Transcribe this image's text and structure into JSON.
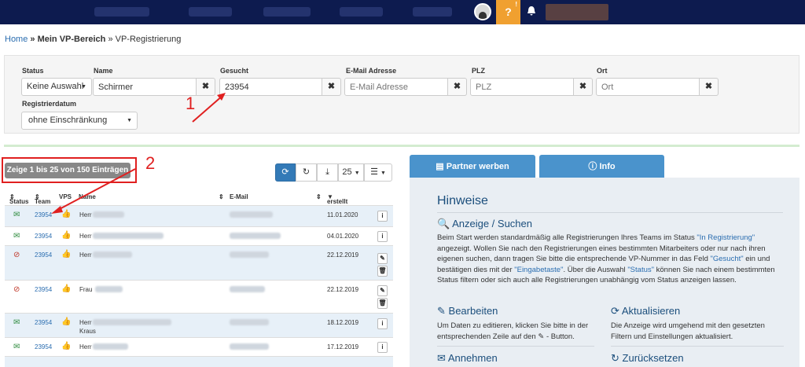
{
  "breadcrumb": {
    "home": "Home",
    "sep1": " » ",
    "mein": "Mein VP-Bereich",
    "sep2": " » ",
    "current": "VP-Registrierung"
  },
  "filter": {
    "status_label": "Status",
    "status_value": "Keine Auswahl",
    "name_label": "Name",
    "name_value": "Schirmer",
    "gesucht_label": "Gesucht",
    "gesucht_value": "23954",
    "email_label": "E-Mail Adresse",
    "email_placeholder": "E-Mail Adresse",
    "plz_label": "PLZ",
    "plz_placeholder": "PLZ",
    "ort_label": "Ort",
    "ort_placeholder": "Ort",
    "regdatum_label": "Registrierdatum",
    "regdatum_value": "ohne Einschränkung",
    "clear": "✖"
  },
  "annotations": {
    "one": "1",
    "two": "2"
  },
  "list": {
    "count_text": "Zeige 1 bis 25 von 150 Einträgen",
    "page_size": "25",
    "headers": {
      "status": "Status",
      "team": "Team",
      "vps": "VPS",
      "name": "Name",
      "email": "E-Mail",
      "erstellt": "erstellt"
    },
    "rows": [
      {
        "icon": "✉",
        "team": "23954",
        "anrede": "Herr",
        "date": "11.01.2020"
      },
      {
        "icon": "✉",
        "team": "23954",
        "anrede": "Herr",
        "date": "04.01.2020"
      },
      {
        "icon": "⊘",
        "team": "23954",
        "anrede": "Herr",
        "date": "22.12.2019"
      },
      {
        "icon": "⊘",
        "team": "23954",
        "anrede": "Frau",
        "date": "22.12.2019"
      },
      {
        "icon": "✉",
        "team": "23954",
        "anrede": "Herr",
        "anrede2": "Kraus",
        "date": "18.12.2019"
      },
      {
        "icon": "✉",
        "team": "23954",
        "anrede": "Herr",
        "date": "17.12.2019"
      }
    ]
  },
  "tabs": {
    "partner": "Partner werben",
    "info": "Info"
  },
  "hinweise": {
    "title": "Hinweise",
    "anzeige_title": "Anzeige / Suchen",
    "anzeige_text_1": "Beim Start werden standardmäßig alle Registrierungen Ihres Teams im Status ",
    "anzeige_hl_1": "\"In Registrierung\"",
    "anzeige_text_2": "angezeigt. Wollen Sie nach den Registrierungen eines bestimmten Mitarbeiters oder nur nach ihren eigenen suchen, dann tragen Sie bitte die entsprechende VP-Nummer in das Feld ",
    "anzeige_hl_2": "\"Gesucht\"",
    "anzeige_text_3": " ein und bestätigen dies mit der ",
    "anzeige_hl_3": "\"Eingabetaste\"",
    "anzeige_text_4": ". Über die Auswahl ",
    "anzeige_hl_4": "\"Status\"",
    "anzeige_text_5": " können Sie nach einem bestimmten Status filtern oder sich auch alle Registrierungen unabhängig vom Status anzeigen lassen.",
    "bearbeiten_title": "Bearbeiten",
    "bearbeiten_text_1": "Um Daten zu editieren, klicken Sie bitte in der entsprechenden Zeile auf den ",
    "bearbeiten_text_2": " - Button.",
    "aktualisieren_title": "Aktualisieren",
    "aktualisieren_text": "Die Anzeige wird umgehend mit den gesetzten Filtern und Einstellungen aktualisiert.",
    "annehmen_title": "Annehmen",
    "zuruecksetzen_title": "Zurücksetzen"
  },
  "colors": {
    "topbar": "#0d1b4f",
    "accent": "#337ab7",
    "tab": "#4a93cc",
    "help": "#f0a030",
    "annotation": "#e02020"
  }
}
